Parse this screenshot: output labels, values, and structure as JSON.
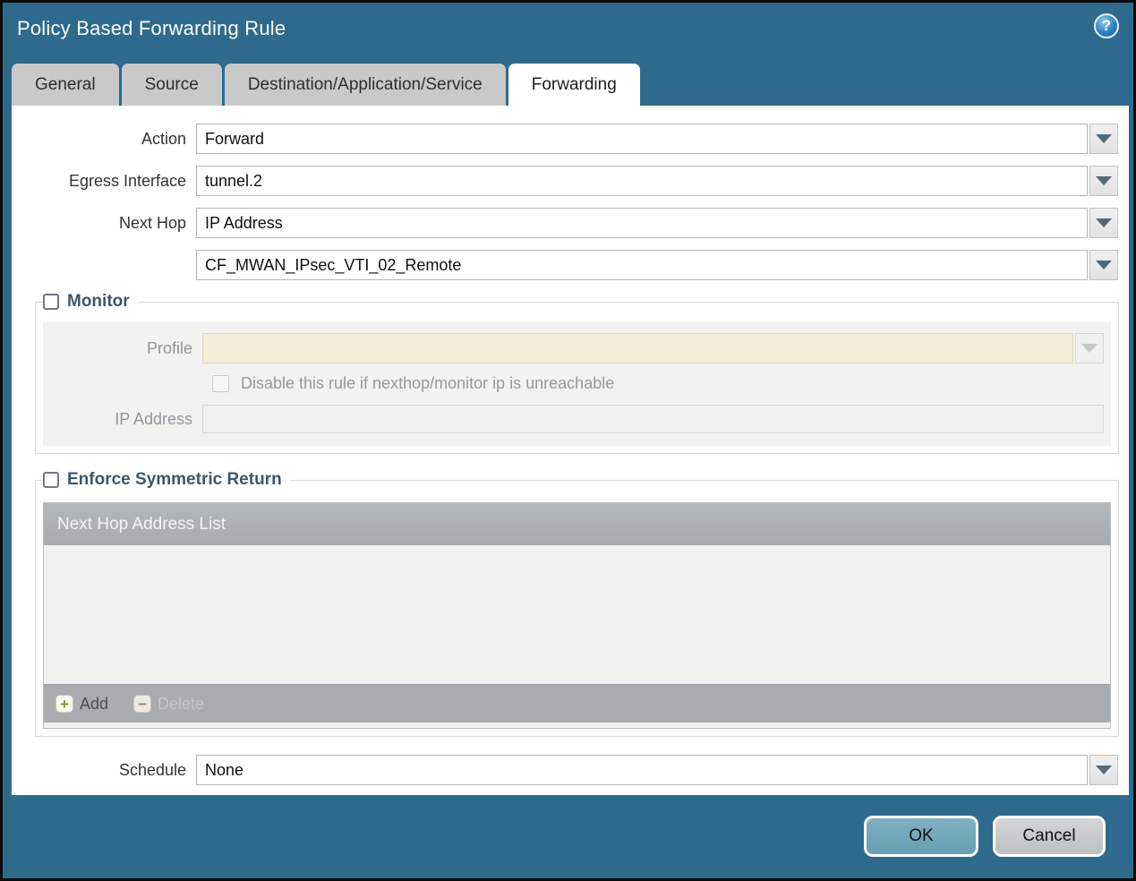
{
  "dialog": {
    "title": "Policy Based Forwarding Rule",
    "help_glyph": "?"
  },
  "tabs": [
    {
      "label": "General",
      "active": false
    },
    {
      "label": "Source",
      "active": false
    },
    {
      "label": "Destination/Application/Service",
      "active": false
    },
    {
      "label": "Forwarding",
      "active": true
    }
  ],
  "form": {
    "action": {
      "label": "Action",
      "value": "Forward"
    },
    "egress_interface": {
      "label": "Egress Interface",
      "value": "tunnel.2"
    },
    "next_hop": {
      "label": "Next Hop",
      "value": "IP Address"
    },
    "next_hop_address": {
      "value": "CF_MWAN_IPsec_VTI_02_Remote"
    },
    "schedule": {
      "label": "Schedule",
      "value": "None"
    }
  },
  "monitor": {
    "legend": "Monitor",
    "checked": false,
    "profile": {
      "label": "Profile",
      "value": ""
    },
    "disable_rule_checkbox": {
      "label": "Disable this rule if nexthop/monitor ip is unreachable",
      "checked": false
    },
    "ip_address": {
      "label": "IP Address",
      "value": ""
    }
  },
  "symmetric_return": {
    "legend": "Enforce Symmetric Return",
    "checked": false,
    "table": {
      "header": "Next Hop Address List",
      "rows": []
    },
    "add_label": "Add",
    "delete_label": "Delete",
    "delete_enabled": false
  },
  "footer": {
    "ok_label": "OK",
    "cancel_label": "Cancel"
  },
  "colors": {
    "window_bg": "#2e6a8c",
    "active_tab_bg": "#ffffff",
    "inactive_tab_bg": "#c9c9c9",
    "table_header_bg": "#adb1b4",
    "disabled_field_bg": "#f3edda",
    "ok_button_bg": "#6fa3b8",
    "cancel_button_bg": "#c6c8ca",
    "add_icon_green": "#7e9e35",
    "delete_icon_red": "#b1776e"
  }
}
